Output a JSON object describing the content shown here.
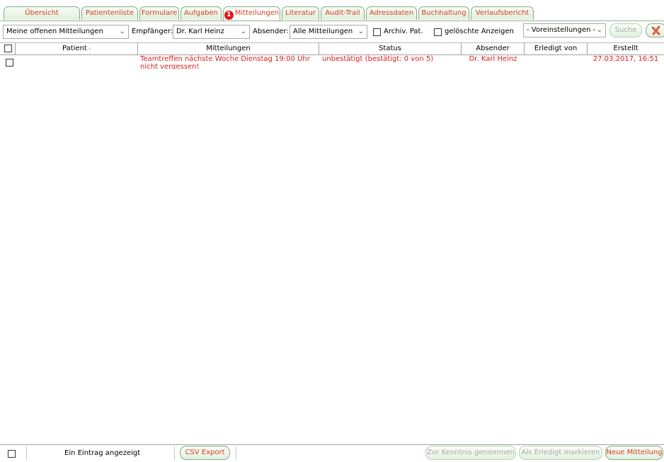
{
  "tabs": [
    {
      "label": "Übersicht"
    },
    {
      "label": "Patientenliste"
    },
    {
      "label": "Formulare"
    },
    {
      "label": "Aufgaben"
    },
    {
      "label": "Mitteilungen",
      "active": true,
      "badge": "1"
    },
    {
      "label": "Literatur"
    },
    {
      "label": "Audit-Trail"
    },
    {
      "label": "Adressdaten"
    },
    {
      "label": "Buchhaltung"
    },
    {
      "label": "Verlaufsbericht"
    }
  ],
  "filters": {
    "view_select": "Meine offenen Mitteilungen",
    "recipient_label": "Empfänger:",
    "recipient_select": "Dr. Karl Heinz",
    "sender_label": "Absender:",
    "sender_select": "Alle Mitteilungen",
    "archived_label": "Archiv. Pat.",
    "deleted_label": "gelöschte Anzeigen",
    "presets_select": "- Voreinstellungen -",
    "search_button": "Suche"
  },
  "table": {
    "columns": [
      "Patient",
      "Mitteilungen",
      "Status",
      "Absender",
      "Erledigt von",
      "Erstellt"
    ],
    "rows": [
      {
        "patient": "",
        "message": "Teamtreffen nächste Woche Dienstag 19:00 Uhr nicht vergessen!",
        "status": "unbestätigt (bestätigt: 0 von 5)",
        "sender": "Dr. Karl Heinz",
        "done_by": "",
        "created": "27.03.2017, 16:51"
      }
    ]
  },
  "footer": {
    "count_text": "Ein Eintrag angezeigt",
    "csv_button": "CSV Export",
    "acknowledge_button": "Zur Kenntnis genommen",
    "mark_done_button": "Als Erledigt markieren",
    "new_message_button": "Neue Mitteilung"
  },
  "colors": {
    "accent_red": "#e01a1a",
    "tab_text": "#d2401e",
    "tab_border_green": "#7fae7f"
  }
}
